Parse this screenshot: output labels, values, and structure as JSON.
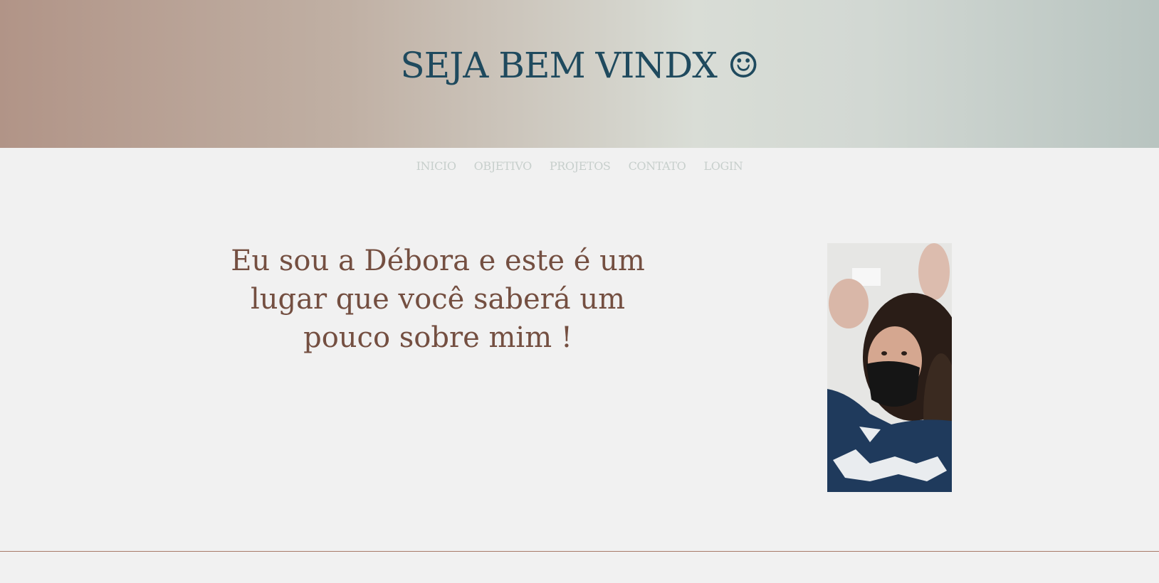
{
  "header": {
    "title": "SEJA BEM VINDX ☺"
  },
  "nav": {
    "items": [
      {
        "label": "INICIO"
      },
      {
        "label": "OBJETIVO"
      },
      {
        "label": "PROJETOS"
      },
      {
        "label": "CONTATO"
      },
      {
        "label": "LOGIN"
      }
    ]
  },
  "main": {
    "intro_text": "Eu sou a Débora e este é um lugar que você saberá um pouco sobre mim !"
  },
  "colors": {
    "title": "#1f4a5e",
    "intro_text": "#744f41",
    "nav_link": "#c7cfcc",
    "divider": "#a87a68",
    "background": "#f1f1f1"
  }
}
